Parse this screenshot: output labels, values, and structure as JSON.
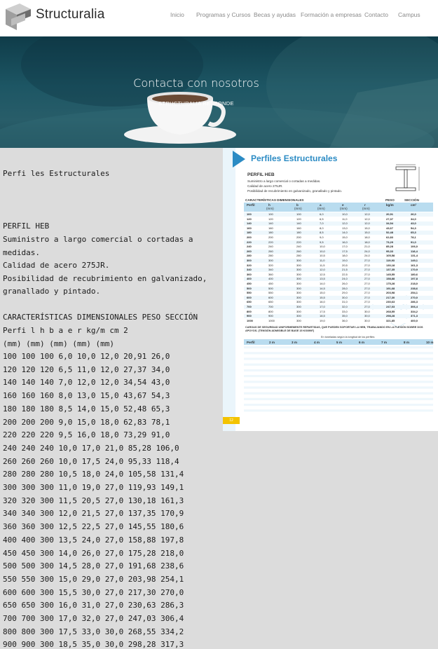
{
  "header": {
    "brand": "Structuralia",
    "nav": [
      "Inicio",
      "Programas y Cursos",
      "Becas y ayudas",
      "Formación a empresas",
      "Contacto",
      "Campus"
    ]
  },
  "hero": {
    "title": "Contacta con nosotros",
    "subtitle": "STRUCTURALIA RESPONDE"
  },
  "text": {
    "heading": "Perfi les Estructurales",
    "perfil": "PERFIL HEB",
    "desc": [
      "Suministro a largo comercial o cortadas a",
      "medidas.",
      "Calidad de acero 275JR.",
      "Posibilidad de recubrimiento en galvanizado,",
      "granallado y pintado."
    ],
    "table_title": "CARACTERÍSTICAS DIMENSIONALES PESO SECCIÓN",
    "table_header": "Perfi l h b a e r kg/m cm 2",
    "table_units": "(mm) (mm) (mm) (mm) (mm)",
    "rows": [
      "100 100 100 6,0 10,0 12,0 20,91 26,0",
      "120 120 120 6,5 11,0 12,0 27,37 34,0",
      "140 140 140 7,0 12,0 12,0 34,54 43,0",
      "160 160 160 8,0 13,0 15,0 43,67 54,3",
      "180 180 180 8,5 14,0 15,0 52,48 65,3",
      "200 200 200 9,0 15,0 18,0 62,83 78,1",
      "220 220 220 9,5 16,0 18,0 73,29 91,0",
      "240 240 240 10,0 17,0 21,0 85,28 106,0",
      "260 260 260 10,0 17,5 24,0 95,33 118,4",
      "280 280 280 10,5 18,0 24,0 105,58 131,4",
      "300 300 300 11,0 19,0 27,0 119,93 149,1",
      "320 320 300 11,5 20,5 27,0 130,18 161,3",
      "340 340 300 12,0 21,5 27,0 137,35 170,9",
      "360 360 300 12,5 22,5 27,0 145,55 180,6",
      "400 400 300 13,5 24,0 27,0 158,88 197,8",
      "450 450 300 14,0 26,0 27,0 175,28 218,0",
      "500 500 300 14,5 28,0 27,0 191,68 238,6",
      "550 550 300 15,0 29,0 27,0 203,98 254,1",
      "600 600 300 15,5 30,0 27,0 217,30 270,0",
      "650 650 300 16,0 31,0 27,0 230,63 286,3",
      "700 700 300 17,0 32,0 27,0 247,03 306,4",
      "800 800 300 17,5 33,0 30,0 268,55 334,2",
      "900 900 300 18,5 35,0 30,0 298,28 317,3"
    ]
  },
  "figure": {
    "title": "Perfiles Estructurales",
    "perfil": "PERFIL HEB",
    "lines": [
      "Suministro a largo comercial o cortadas a medidas.",
      "Calidad de acero 275JR.",
      "Posibilidad de recubrimiento en galvanizado, granallado y pintado."
    ],
    "table_title": "CARACTERÍSTICAS DIMENSIONALES",
    "peso": "PESO",
    "seccion": "SECCIÓN",
    "headers": [
      "Perfil",
      "h",
      "b",
      "a",
      "e",
      "r",
      "kg/m",
      "cm²"
    ],
    "units": "(mm)",
    "rows": [
      [
        "100",
        "100",
        "100",
        "6,0",
        "10,0",
        "12,0",
        "20,91",
        "26,0"
      ],
      [
        "120",
        "120",
        "120",
        "6,5",
        "11,0",
        "12,0",
        "27,37",
        "34,0"
      ],
      [
        "140",
        "140",
        "140",
        "7,0",
        "12,0",
        "12,0",
        "34,54",
        "43,0"
      ],
      [
        "160",
        "160",
        "160",
        "8,0",
        "13,0",
        "15,0",
        "43,67",
        "54,3"
      ],
      [
        "180",
        "180",
        "180",
        "8,5",
        "14,0",
        "15,0",
        "52,48",
        "65,3"
      ],
      [
        "200",
        "200",
        "200",
        "9,0",
        "15,0",
        "18,0",
        "62,83",
        "78,1"
      ],
      [
        "220",
        "220",
        "220",
        "9,5",
        "16,0",
        "18,0",
        "73,29",
        "91,0"
      ],
      [
        "240",
        "240",
        "240",
        "10,0",
        "17,0",
        "21,0",
        "85,28",
        "106,0"
      ],
      [
        "260",
        "260",
        "260",
        "10,0",
        "17,5",
        "24,0",
        "95,33",
        "118,4"
      ],
      [
        "280",
        "280",
        "280",
        "10,5",
        "18,0",
        "24,0",
        "105,58",
        "131,4"
      ],
      [
        "300",
        "300",
        "300",
        "11,0",
        "19,0",
        "27,0",
        "119,93",
        "149,1"
      ],
      [
        "320",
        "320",
        "300",
        "11,5",
        "20,5",
        "27,0",
        "130,18",
        "161,3"
      ],
      [
        "340",
        "340",
        "300",
        "12,0",
        "21,5",
        "27,0",
        "137,35",
        "170,9"
      ],
      [
        "360",
        "360",
        "300",
        "12,5",
        "22,5",
        "27,0",
        "145,55",
        "180,6"
      ],
      [
        "400",
        "400",
        "300",
        "13,5",
        "24,0",
        "27,0",
        "158,88",
        "197,8"
      ],
      [
        "450",
        "450",
        "300",
        "14,0",
        "26,0",
        "27,0",
        "175,28",
        "218,0"
      ],
      [
        "500",
        "500",
        "300",
        "14,5",
        "28,0",
        "27,0",
        "191,68",
        "238,6"
      ],
      [
        "550",
        "550",
        "300",
        "15,0",
        "29,0",
        "27,0",
        "203,98",
        "254,1"
      ],
      [
        "600",
        "600",
        "300",
        "15,5",
        "30,0",
        "27,0",
        "217,30",
        "270,0"
      ],
      [
        "650",
        "650",
        "300",
        "16,0",
        "31,0",
        "27,0",
        "230,63",
        "286,3"
      ],
      [
        "700",
        "700",
        "300",
        "17,0",
        "32,0",
        "27,0",
        "247,03",
        "306,4"
      ],
      [
        "800",
        "800",
        "300",
        "17,5",
        "33,0",
        "30,0",
        "268,55",
        "334,2"
      ],
      [
        "900",
        "900",
        "300",
        "18,5",
        "35,0",
        "30,0",
        "298,28",
        "371,3"
      ],
      [
        "1000",
        "1000",
        "300",
        "19,0",
        "36,0",
        "30,0",
        "321,85",
        "400,0"
      ]
    ],
    "loads_title": "CARGAS DE SEGURIDAD UNIFORMEMENTE REPARTIDAS, QUE PUEDEN SOPORTAR LA HEB, TRABAJANDO EN LA FLEXIÓN SOBRE DOS APOYOS. (TENSIÓN ADMISIBLE DE BASE 15 KG/MM²)",
    "loads_sub": "En toneladas según la longitud de los perfiles",
    "loads_headers": [
      "Perfil",
      "2 m",
      "3 m",
      "4 m",
      "5 m",
      "6 m",
      "7 m",
      "8 m",
      "10 m"
    ],
    "page": "12"
  },
  "colors": {
    "accent": "#2b8bc4",
    "table_head": "#b9dcef",
    "badge": "#f3c300"
  }
}
